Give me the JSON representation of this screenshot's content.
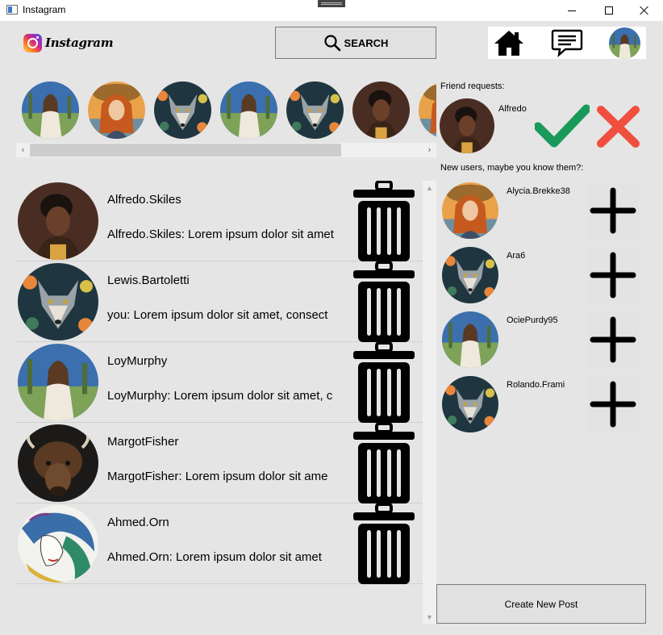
{
  "window": {
    "title": "Instagram"
  },
  "header": {
    "logo_text": "Instagram",
    "search_label": "SEARCH",
    "nav_icons": [
      "home-icon",
      "chat-icon",
      "avatar"
    ]
  },
  "stories": [
    {
      "avatar": "field-woman"
    },
    {
      "avatar": "orange-hair-woman"
    },
    {
      "avatar": "wolf"
    },
    {
      "avatar": "field-woman"
    },
    {
      "avatar": "wolf"
    },
    {
      "avatar": "portrait-woman"
    },
    {
      "avatar": "orange-hair-woman"
    }
  ],
  "chats": [
    {
      "name": "Alfredo.Skiles",
      "preview": "Alfredo.Skiles: Lorem ipsum dolor sit amet",
      "avatar": "portrait-woman"
    },
    {
      "name": "Lewis.Bartoletti",
      "preview": "you: Lorem ipsum dolor sit amet, consect",
      "avatar": "wolf"
    },
    {
      "name": "LoyMurphy",
      "preview": "LoyMurphy: Lorem ipsum dolor sit amet, c",
      "avatar": "field-woman"
    },
    {
      "name": "MargotFisher",
      "preview": "MargotFisher: Lorem ipsum dolor sit ame",
      "avatar": "bison"
    },
    {
      "name": "Ahmed.Orn",
      "preview": "Ahmed.Orn: Lorem ipsum dolor sit amet",
      "avatar": "art-face"
    }
  ],
  "friend_requests": {
    "title": "Friend requests:",
    "items": [
      {
        "name": "Alfredo",
        "avatar": "portrait-woman"
      }
    ]
  },
  "new_users": {
    "title": "New users, maybe you know them?:",
    "items": [
      {
        "name": "Alycia.Brekke38",
        "avatar": "orange-hair-woman"
      },
      {
        "name": "Ara6",
        "avatar": "wolf"
      },
      {
        "name": "OciePurdy95",
        "avatar": "field-woman"
      },
      {
        "name": "Rolando.Frami",
        "avatar": "wolf"
      }
    ]
  },
  "create_post_label": "Create New Post",
  "colors": {
    "accept": "#1a9a5a",
    "decline": "#f04e3e",
    "background": "#e5e5e5"
  }
}
